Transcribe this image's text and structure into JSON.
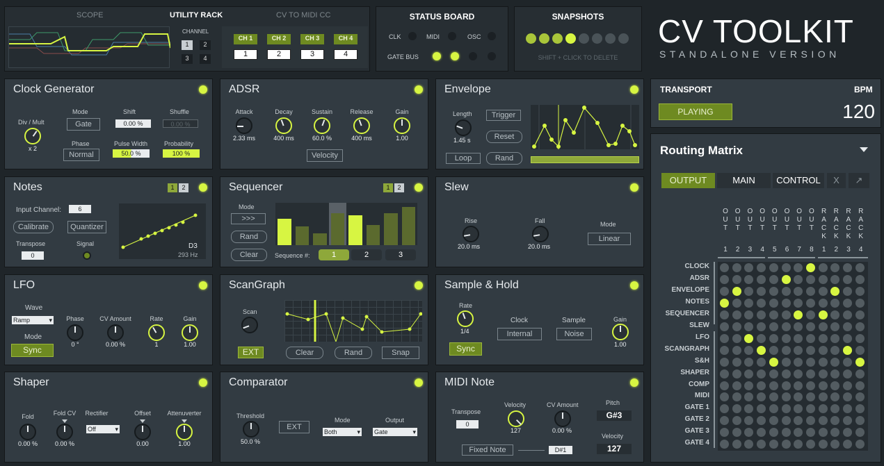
{
  "utility": {
    "tab_scope": "SCOPE",
    "tab_utility": "UTILITY RACK",
    "tab_cv": "CV TO MIDI CC",
    "channel_label": "CHANNEL",
    "ch_btns": [
      "1",
      "2",
      "3",
      "4"
    ],
    "cc_heads": [
      "CH 1",
      "CH 2",
      "CH 3",
      "CH 4"
    ],
    "cc_vals": [
      "1",
      "2",
      "3",
      "4"
    ]
  },
  "status": {
    "title": "STATUS BOARD",
    "clk": "CLK",
    "midi": "MIDI",
    "osc": "OSC",
    "gate": "GATE BUS"
  },
  "snapshots": {
    "title": "SNAPSHOTS",
    "hint": "SHIFT + CLICK TO DELETE",
    "states": [
      true,
      true,
      true,
      true,
      false,
      false,
      false,
      false
    ]
  },
  "brand": {
    "title": "CV TOOLKIT",
    "subtitle": "STANDALONE VERSION"
  },
  "transport": {
    "title": "TRANSPORT",
    "bpm_label": "BPM",
    "status": "PLAYING",
    "bpm": "120"
  },
  "routing": {
    "title": "Routing Matrix",
    "tabs": [
      "OUTPUT",
      "MAIN",
      "CONTROL",
      "X",
      "↗"
    ],
    "col_letters": [
      [
        "O",
        "U",
        "T"
      ],
      [
        "O",
        "U",
        "T"
      ],
      [
        "O",
        "U",
        "T"
      ],
      [
        "O",
        "U",
        "T"
      ],
      [
        "O",
        "U",
        "T"
      ],
      [
        "O",
        "U",
        "T"
      ],
      [
        "O",
        "U",
        "T"
      ],
      [
        "O",
        "U",
        "T"
      ],
      [
        "R",
        "A",
        "C",
        "K"
      ],
      [
        "R",
        "A",
        "C",
        "K"
      ],
      [
        "R",
        "A",
        "C",
        "K"
      ],
      [
        "R",
        "A",
        "C",
        "K"
      ]
    ],
    "col_nums": [
      "1",
      "2",
      "3",
      "4",
      "5",
      "6",
      "7",
      "8",
      "1",
      "2",
      "3",
      "4"
    ],
    "rows": [
      "CLOCK",
      "ADSR",
      "ENVELOPE",
      "NOTES",
      "SEQUENCER",
      "SLEW",
      "LFO",
      "SCANGRAPH",
      "S&H",
      "SHAPER",
      "COMP",
      "MIDI",
      "GATE 1",
      "GATE 2",
      "GATE 3",
      "GATE 4"
    ],
    "on": [
      [
        0,
        7
      ],
      [
        1,
        5
      ],
      [
        2,
        1
      ],
      [
        2,
        9
      ],
      [
        3,
        0
      ],
      [
        4,
        6
      ],
      [
        4,
        8
      ],
      [
        6,
        2
      ],
      [
        7,
        3
      ],
      [
        7,
        10
      ],
      [
        8,
        4
      ],
      [
        8,
        11
      ]
    ]
  },
  "clock": {
    "title": "Clock Generator",
    "divmult": "Div / Mult",
    "divval": "x 2",
    "mode_l": "Mode",
    "mode_v": "Gate",
    "shift_l": "Shift",
    "shift_v": "0.00 %",
    "shuffle_l": "Shuffle",
    "shuffle_v": "0.00 %",
    "phase_l": "Phase",
    "phase_v": "Normal",
    "pw_l": "Pulse Width",
    "pw_v": "50.0 %",
    "prob_l": "Probability",
    "prob_v": "100 %"
  },
  "adsr": {
    "title": "ADSR",
    "labels": [
      "Attack",
      "Decay",
      "Sustain",
      "Release",
      "Gain"
    ],
    "values": [
      "2.33 ms",
      "400 ms",
      "60.0 %",
      "400 ms",
      "1.00"
    ],
    "velocity": "Velocity"
  },
  "envelope": {
    "title": "Envelope",
    "length_l": "Length",
    "length_v": "1.45 s",
    "trigger": "Trigger",
    "reset": "Reset",
    "loop": "Loop",
    "rand": "Rand"
  },
  "notes": {
    "title": "Notes",
    "tabs": [
      "1",
      "2"
    ],
    "input_l": "Input Channel:",
    "input_v": "6",
    "calibrate": "Calibrate",
    "quantizer": "Quantizer",
    "transpose_l": "Transpose",
    "transpose_v": "0",
    "signal_l": "Signal",
    "note": "D3",
    "hz": "293 Hz"
  },
  "sequencer": {
    "title": "Sequencer",
    "tabs": [
      "1",
      "2"
    ],
    "mode_l": "Mode",
    "mode_v": ">>>",
    "rand": "Rand",
    "clear": "Clear",
    "seqnum_l": "Sequence #:",
    "seqs": [
      "1",
      "2",
      "3"
    ],
    "steps": [
      0.62,
      0.45,
      0.28,
      0.75,
      0.7,
      0.48,
      0.75,
      0.9
    ]
  },
  "slew": {
    "title": "Slew",
    "rise_l": "Rise",
    "rise_v": "20.0 ms",
    "fall_l": "Fall",
    "fall_v": "20.0 ms",
    "mode_l": "Mode",
    "mode_v": "Linear"
  },
  "lfo": {
    "title": "LFO",
    "wave_l": "Wave",
    "wave_v": "Ramp",
    "mode_l": "Mode",
    "sync": "Sync",
    "labels": [
      "Phase",
      "CV Amount",
      "Rate",
      "Gain"
    ],
    "values": [
      "0 °",
      "0.00 %",
      "1",
      "1.00"
    ]
  },
  "scangraph": {
    "title": "ScanGraph",
    "scan_l": "Scan",
    "ext": "EXT",
    "clear": "Clear",
    "rand": "Rand",
    "snap": "Snap"
  },
  "sh": {
    "title": "Sample & Hold",
    "rate_l": "Rate",
    "rate_v": "1/4",
    "sync": "Sync",
    "clock_l": "Clock",
    "clock_v": "Internal",
    "sample_l": "Sample",
    "sample_v": "Noise",
    "gain_l": "Gain",
    "gain_v": "1.00"
  },
  "shaper": {
    "title": "Shaper",
    "labels": [
      "Fold",
      "Fold CV",
      "Rectifier",
      "Offset",
      "Attenuverter"
    ],
    "values": [
      "0.00 %",
      "0.00 %",
      "Off",
      "0.00",
      "1.00"
    ]
  },
  "comparator": {
    "title": "Comparator",
    "thresh_l": "Threshold",
    "thresh_v": "50.0 %",
    "ext": "EXT",
    "mode_l": "Mode",
    "mode_v": "Both",
    "output_l": "Output",
    "output_v": "Gate"
  },
  "midinote": {
    "title": "MIDI Note",
    "transpose_l": "Transpose",
    "transpose_v": "0",
    "vel_l": "Velocity",
    "vel_v": "127",
    "cv_l": "CV Amount",
    "cv_v": "0.00 %",
    "pitch_l": "Pitch",
    "pitch_v": "G#3",
    "velo_l": "Velocity",
    "velo_v": "127",
    "fixed": "Fixed Note",
    "fixed_v": "D#1"
  }
}
